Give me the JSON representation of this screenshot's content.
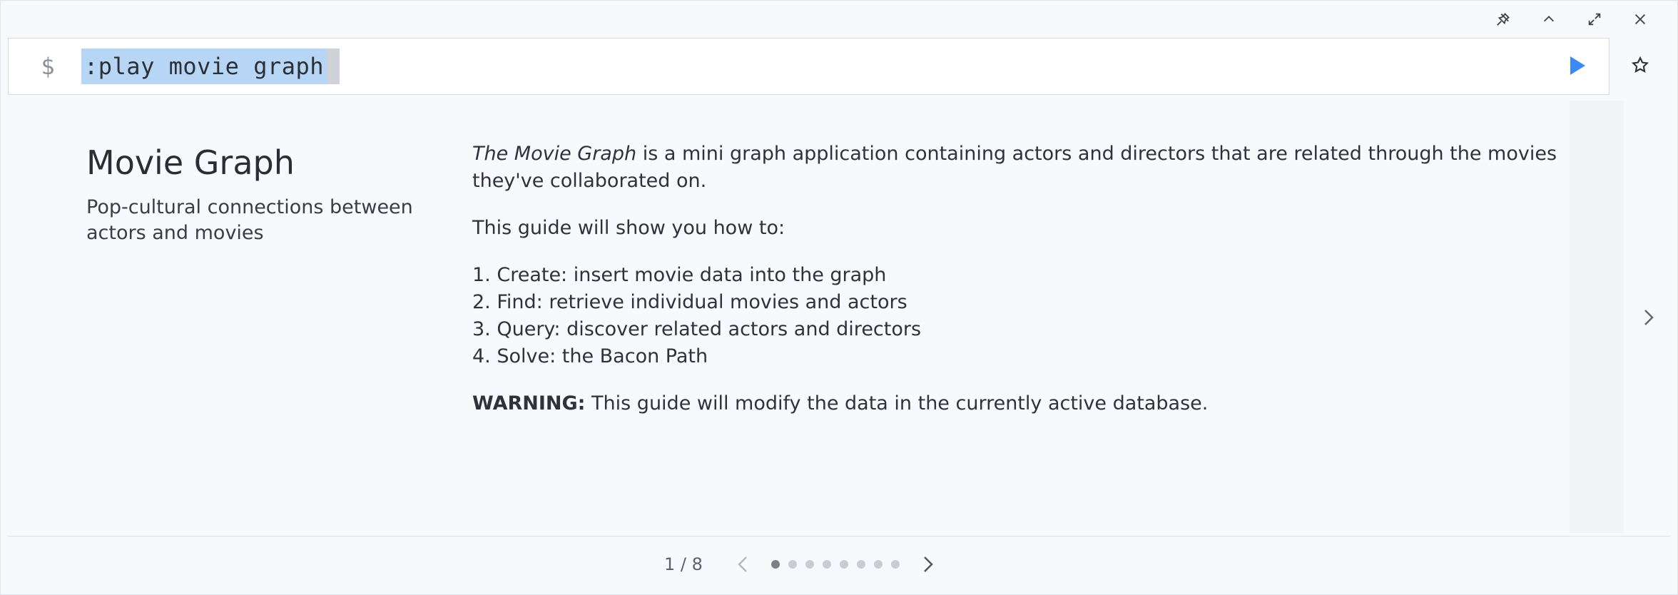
{
  "editor": {
    "prompt": "$",
    "command": ":play movie graph"
  },
  "window_controls": [
    "pin-icon",
    "collapse-icon",
    "fullscreen-icon",
    "close-icon"
  ],
  "guide": {
    "title": "Movie Graph",
    "subtitle": "Pop-cultural connections between actors and movies",
    "intro_em": "The Movie Graph",
    "intro_rest": " is a mini graph application containing actors and directors that are related through the movies they've collaborated on.",
    "lead": "This guide will show you how to:",
    "steps": [
      "1. Create: insert movie data into the graph",
      "2. Find: retrieve individual movies and actors",
      "3. Query: discover related actors and directors",
      "4. Solve: the Bacon Path"
    ],
    "warning_label": "WARNING:",
    "warning_text": " This guide will modify the data in the currently active database."
  },
  "pager": {
    "label": "1 / 8",
    "total": 8,
    "current": 1
  },
  "colors": {
    "run_button": "#3d8af7",
    "selection": "#b7d5f5"
  }
}
